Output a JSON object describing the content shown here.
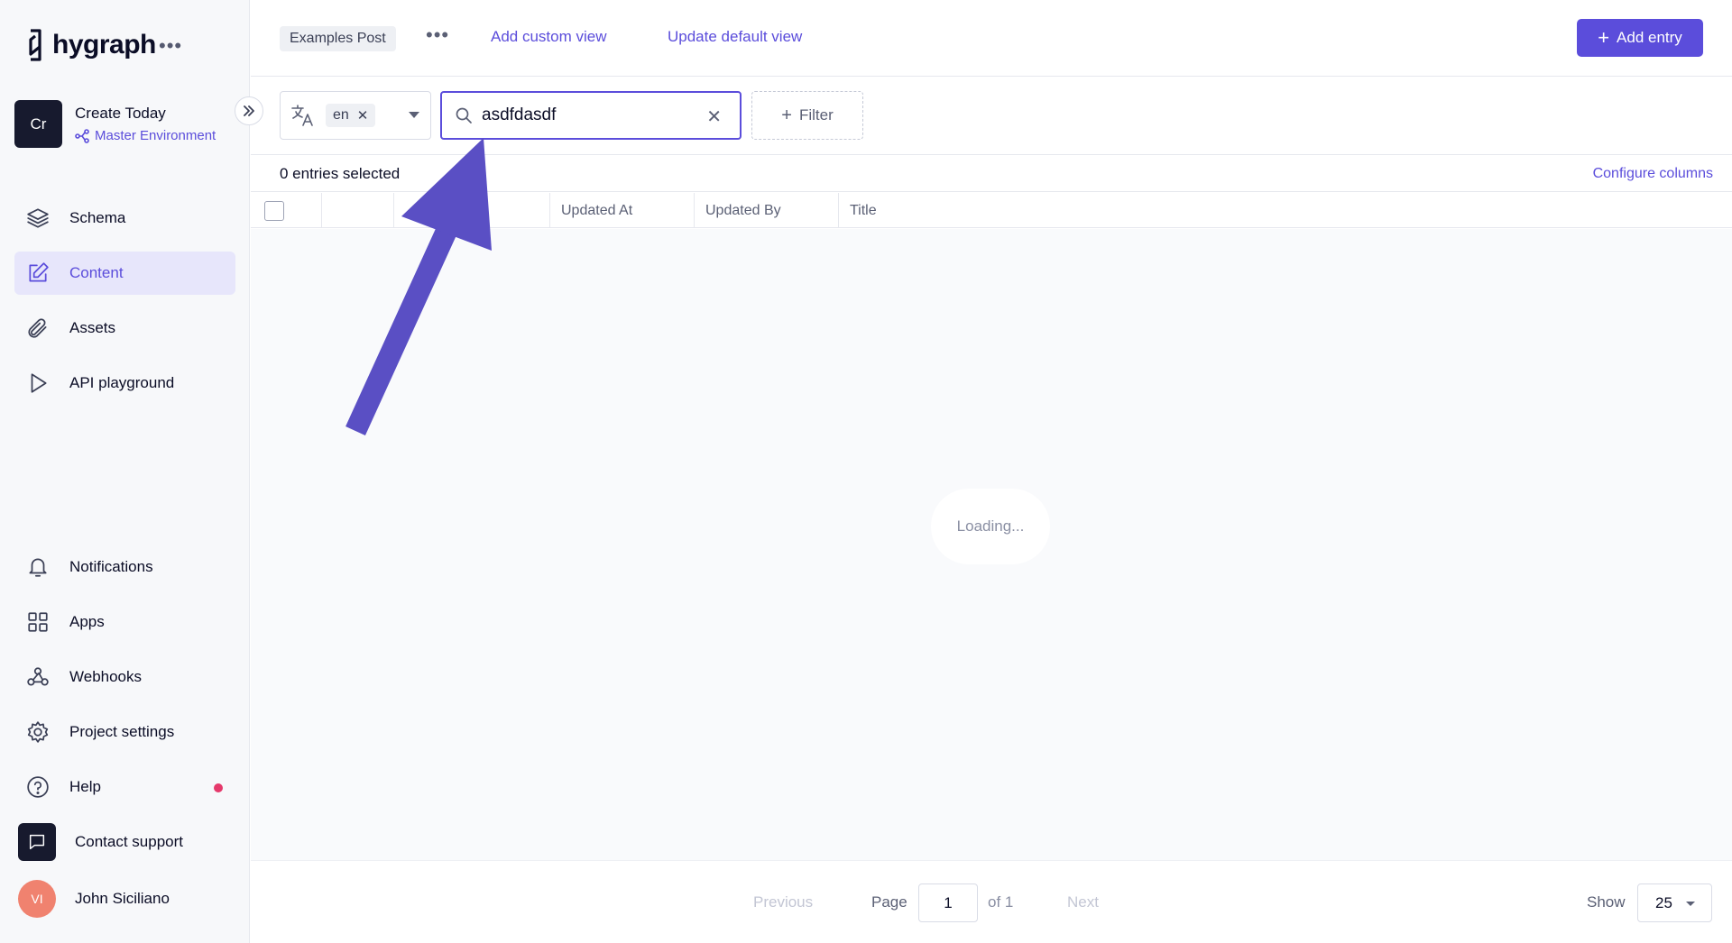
{
  "brand": {
    "name": "hygraph",
    "menu_glyph": "•••"
  },
  "project": {
    "initials": "Cr",
    "name": "Create Today",
    "environment": "Master Environment"
  },
  "nav": {
    "schema": "Schema",
    "content": "Content",
    "assets": "Assets",
    "api_playground": "API playground",
    "notifications": "Notifications",
    "apps": "Apps",
    "webhooks": "Webhooks",
    "project_settings": "Project settings",
    "help": "Help",
    "contact_support": "Contact support"
  },
  "user": {
    "initials": "VI",
    "name": "John Siciliano"
  },
  "topbar": {
    "view_tab": "Examples Post",
    "more_glyph": "•••",
    "add_custom_view": "Add custom view",
    "update_default_view": "Update default view",
    "add_entry": "Add entry"
  },
  "toolbar": {
    "locale": "en",
    "search_value": "asdfdasdf",
    "filter_label": "Filter"
  },
  "table": {
    "selected_count": "0 entries selected",
    "configure_columns": "Configure columns",
    "columns": [
      "Updated At",
      "Updated By",
      "Title"
    ],
    "loading": "Loading..."
  },
  "pagination": {
    "previous": "Previous",
    "page_label": "Page",
    "page": "1",
    "of_label": "of 1",
    "next": "Next",
    "show_label": "Show",
    "page_size": "25"
  },
  "colors": {
    "accent": "#5b4ddb",
    "arrow": "#5a4fc4",
    "alert": "#e5396b"
  }
}
